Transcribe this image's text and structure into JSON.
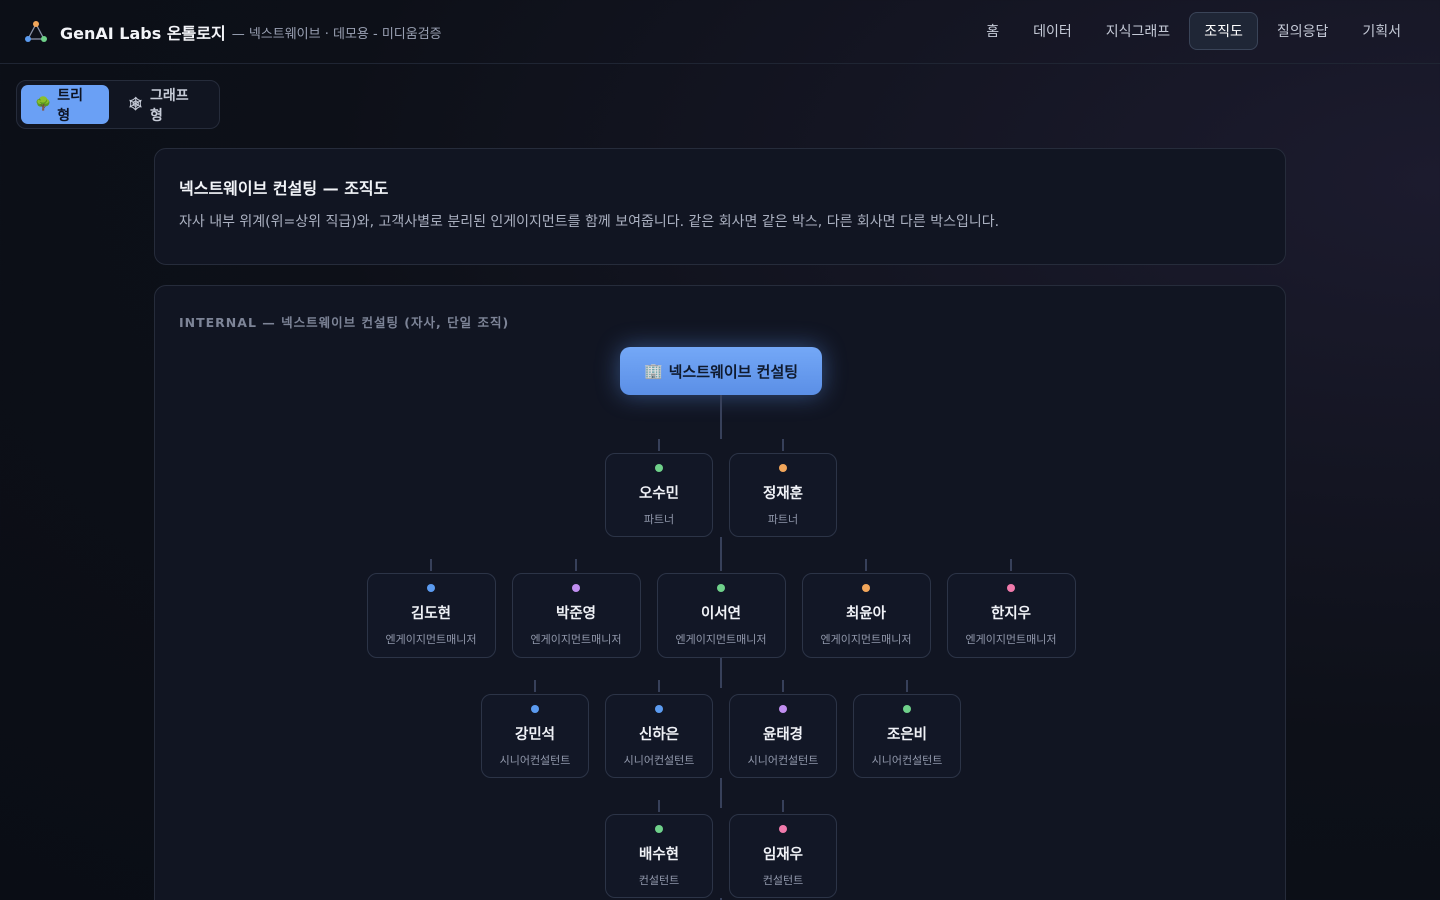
{
  "app": {
    "title": "GenAI Labs 온톨로지",
    "subtitle": "— 넥스트웨이브 · 데모용 - 미디움검증"
  },
  "nav": {
    "items": [
      "홈",
      "데이터",
      "지식그래프",
      "조직도",
      "질의응답",
      "기획서"
    ],
    "active": "조직도"
  },
  "view_toggle": {
    "tree": {
      "icon": "🌳",
      "label": "트리형"
    },
    "graph": {
      "icon": "🕸",
      "label": "그래프형"
    },
    "active": "tree"
  },
  "intro": {
    "title": "넥스트웨이브 컨설팅 — 조직도",
    "description": "자사 내부 위계(위=상위 직급)와, 고객사별로 분리된 인게이지먼트를 함께 보여줍니다. 같은 회사면 같은 박스, 다른 회사면 다른 박스입니다."
  },
  "org": {
    "section_label": "INTERNAL — 넥스트웨이브 컨설팅 (자사, 단일 조직)",
    "root": {
      "icon": "🏢",
      "label": "넥스트웨이브 컨설팅"
    },
    "levels": [
      {
        "people": [
          {
            "name": "오수민",
            "role": "파트너",
            "color": "#6fd18a"
          },
          {
            "name": "정재훈",
            "role": "파트너",
            "color": "#f2a65a"
          }
        ]
      },
      {
        "people": [
          {
            "name": "김도현",
            "role": "엔게이지먼트매니저",
            "color": "#5b9bf0"
          },
          {
            "name": "박준영",
            "role": "엔게이지먼트매니저",
            "color": "#c08ef0"
          },
          {
            "name": "이서연",
            "role": "엔게이지먼트매니저",
            "color": "#6fd18a"
          },
          {
            "name": "최윤아",
            "role": "엔게이지먼트매니저",
            "color": "#f2a65a"
          },
          {
            "name": "한지우",
            "role": "엔게이지먼트매니저",
            "color": "#f07aab"
          }
        ]
      },
      {
        "people": [
          {
            "name": "강민석",
            "role": "시니어컨설턴트",
            "color": "#5b9bf0"
          },
          {
            "name": "신하은",
            "role": "시니어컨설턴트",
            "color": "#5b9bf0"
          },
          {
            "name": "윤태경",
            "role": "시니어컨설턴트",
            "color": "#c08ef0"
          },
          {
            "name": "조은비",
            "role": "시니어컨설턴트",
            "color": "#6fd18a"
          }
        ]
      },
      {
        "people": [
          {
            "name": "배수현",
            "role": "컨설턴트",
            "color": "#6fd18a"
          },
          {
            "name": "임재우",
            "role": "컨설턴트",
            "color": "#f07aab"
          }
        ]
      }
    ]
  }
}
